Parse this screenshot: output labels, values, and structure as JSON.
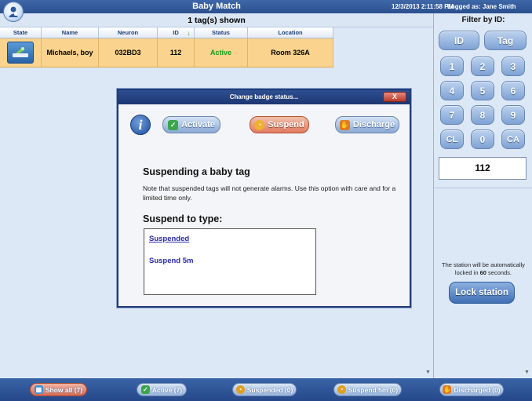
{
  "window": {
    "title": "Baby Match",
    "datetime": "12/3/2013 2:11:58 PM",
    "logged_as": "Logged as: Jane Smith"
  },
  "list": {
    "count_text": "1 tag(s) shown",
    "columns": [
      "State",
      "Name",
      "Neuron",
      "ID",
      "Status",
      "Location"
    ],
    "rows": [
      {
        "name": "Michaels, boy",
        "neuron": "032BD3",
        "id": "112",
        "status": "Active",
        "location": "Room 326A"
      }
    ]
  },
  "filter": {
    "label": "Filter by ID:",
    "keys": {
      "id": "ID",
      "tag": "Tag",
      "k1": "1",
      "k2": "2",
      "k3": "3",
      "k4": "4",
      "k5": "5",
      "k6": "6",
      "k7": "7",
      "k8": "8",
      "k9": "9",
      "cl": "CL",
      "k0": "0",
      "ca": "CA"
    },
    "value": "112"
  },
  "lock": {
    "note_prefix": "The station will be automatically locked in ",
    "seconds": "60",
    "note_suffix": " seconds.",
    "button": "Lock station"
  },
  "dialog": {
    "title": "Change badge status...",
    "close": "X",
    "buttons": {
      "activate": "Activate",
      "suspend": "Suspend",
      "discharge": "Discharge"
    },
    "heading": "Suspending a baby tag",
    "note": "Note that suspended tags will not generate alarms. Use this option with care and for a limited time only.",
    "subheading": "Suspend to type:",
    "options": [
      "Suspended",
      "Suspend 5m"
    ]
  },
  "bottom": {
    "show_all": "Show all (7)",
    "active": "Active (7)",
    "suspended": "Suspended (0)",
    "suspend5m": "Suspend 5m (0)",
    "discharged": "Discharged (0)"
  },
  "colors": {
    "row_highlight": "#fad38e",
    "active_status": "#159b15",
    "title_bar": "#2a4f8e"
  }
}
